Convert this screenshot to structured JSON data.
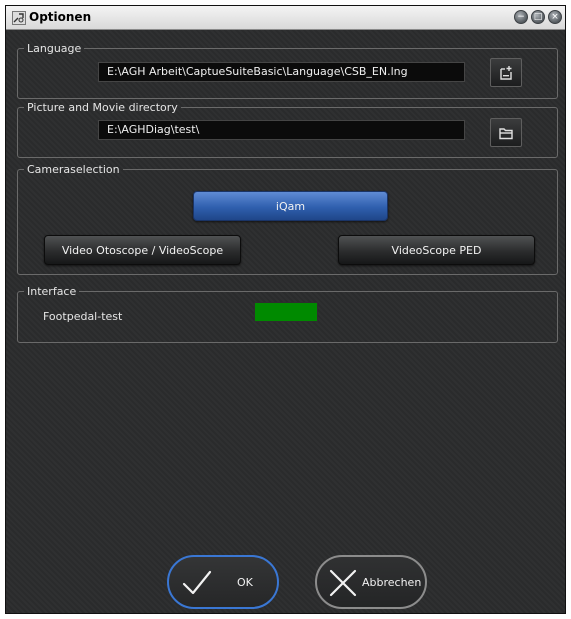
{
  "window": {
    "title": "Optionen"
  },
  "language": {
    "legend": "Language",
    "path": "E:\\AGH Arbeit\\CaptueSuiteBasic\\Language\\CSB_EN.lng"
  },
  "picture_dir": {
    "legend": "Picture and Movie directory",
    "path": "E:\\AGHDiag\\test\\"
  },
  "camera": {
    "legend": "Cameraselection",
    "buttons": [
      "iQam",
      "Video Otoscope / VideoScope",
      "VideoScope PED"
    ],
    "selected": "iQam"
  },
  "interface": {
    "legend": "Interface",
    "footpedal_label": "Footpedal-test",
    "footpedal_color": "#008a00"
  },
  "actions": {
    "ok_label": "OK",
    "cancel_label": "Abbrechen"
  },
  "colors": {
    "accent": "#3a77d4",
    "selected_button": "#2f5fae"
  }
}
